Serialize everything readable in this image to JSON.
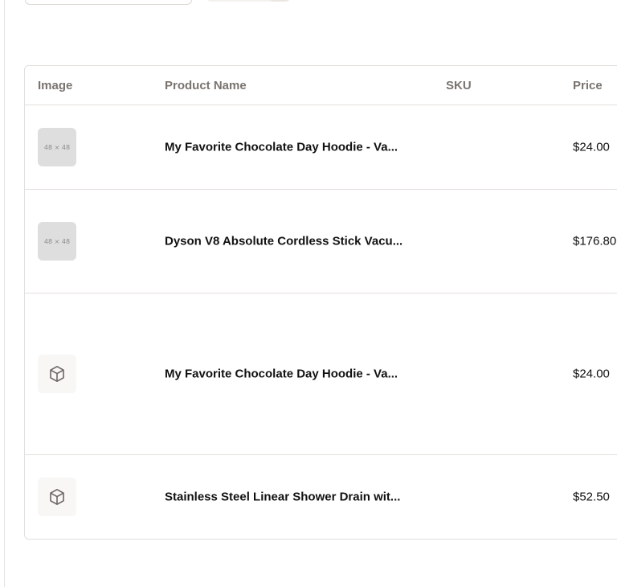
{
  "table": {
    "headers": {
      "image": "Image",
      "product_name": "Product Name",
      "sku": "SKU",
      "price": "Price"
    },
    "rows": [
      {
        "image": {
          "type": "placeholder",
          "label": "48 × 48"
        },
        "name": "My Favorite Chocolate Day Hoodie - Va...",
        "sku": "",
        "price": "$24.00"
      },
      {
        "image": {
          "type": "placeholder",
          "label": "48 × 48"
        },
        "name": "Dyson V8 Absolute Cordless Stick Vacu...",
        "sku": "",
        "price": "$176.80"
      },
      {
        "image": {
          "type": "icon",
          "icon": "box-icon"
        },
        "name": "My Favorite Chocolate Day Hoodie - Va...",
        "sku": "",
        "price": "$24.00"
      },
      {
        "image": {
          "type": "icon",
          "icon": "box-icon"
        },
        "name": "Stainless Steel Linear Shower Drain wit...",
        "sku": "",
        "price": "$52.50"
      }
    ]
  },
  "colors": {
    "border": "#e3e0dc",
    "header_text": "#7a7470",
    "placeholder_bg": "#dedede"
  }
}
